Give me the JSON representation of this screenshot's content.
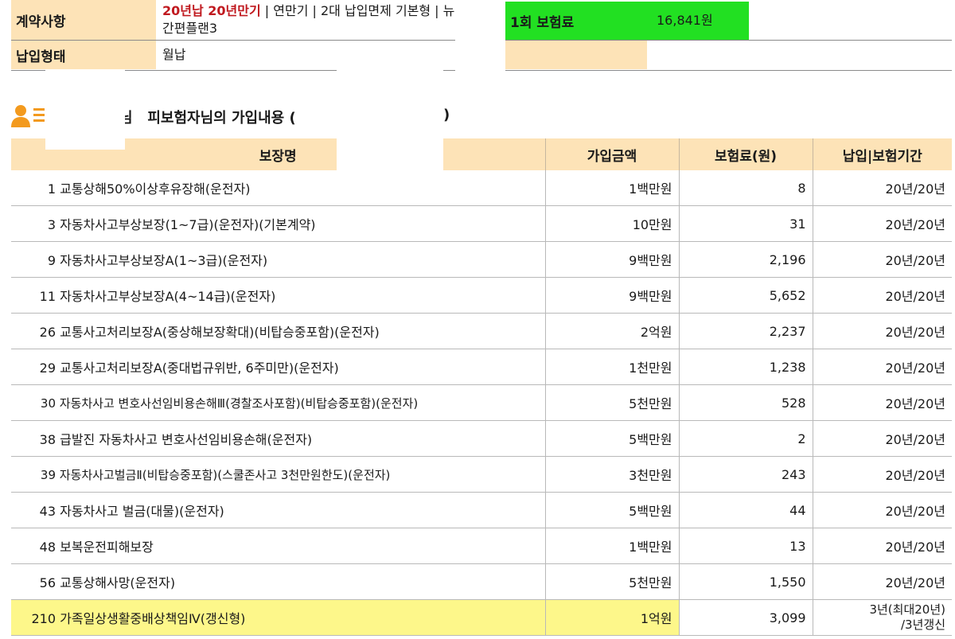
{
  "header": {
    "contract_label": "계약사항",
    "contract_value_red": "20년납 20년만기",
    "contract_value_rest": " |  연만기 | 2대 납입면제 기본형 | 뉴간편플랜3",
    "payment_label": "납입형태",
    "payment_value": "월납",
    "premium_label": "1회 보험료",
    "premium_value": "16,841원"
  },
  "section": {
    "title_part1": "님",
    "title_part2": "피보험자님의 가입내용 (",
    "title_part3": ")"
  },
  "table": {
    "headers": [
      "보장명",
      "가입금액",
      "보험료(원)",
      "납입|보험기간"
    ],
    "rows": [
      {
        "no": "1",
        "name": "교통상해50%이상후유장해(운전자)",
        "amount": "1백만원",
        "premium": "8",
        "period": "20년/20년"
      },
      {
        "no": "3",
        "name": "자동차사고부상보장(1~7급)(운전자)(기본계약)",
        "amount": "10만원",
        "premium": "31",
        "period": "20년/20년"
      },
      {
        "no": "9",
        "name": "자동차사고부상보장A(1~3급)(운전자)",
        "amount": "9백만원",
        "premium": "2,196",
        "period": "20년/20년"
      },
      {
        "no": "11",
        "name": "자동차사고부상보장A(4~14급)(운전자)",
        "amount": "9백만원",
        "premium": "5,652",
        "period": "20년/20년"
      },
      {
        "no": "26",
        "name": "교통사고처리보장A(중상해보장확대)(비탑승중포함)(운전자)",
        "amount": "2억원",
        "premium": "2,237",
        "period": "20년/20년"
      },
      {
        "no": "29",
        "name": "교통사고처리보장A(중대법규위반, 6주미만)(운전자)",
        "amount": "1천만원",
        "premium": "1,238",
        "period": "20년/20년"
      },
      {
        "no": "30",
        "name": "자동차사고 변호사선임비용손해Ⅲ(경찰조사포함)(비탑승중포함)(운전자)",
        "amount": "5천만원",
        "premium": "528",
        "period": "20년/20년"
      },
      {
        "no": "38",
        "name": "급발진 자동차사고 변호사선임비용손해(운전자)",
        "amount": "5백만원",
        "premium": "2",
        "period": "20년/20년"
      },
      {
        "no": "39",
        "name": "자동차사고벌금Ⅱ(비탑승중포함)(스쿨존사고 3천만원한도)(운전자)",
        "amount": "3천만원",
        "premium": "243",
        "period": "20년/20년"
      },
      {
        "no": "43",
        "name": "자동차사고 벌금(대물)(운전자)",
        "amount": "5백만원",
        "premium": "44",
        "period": "20년/20년"
      },
      {
        "no": "48",
        "name": "보복운전피해보장",
        "amount": "1백만원",
        "premium": "13",
        "period": "20년/20년"
      },
      {
        "no": "56",
        "name": "교통상해사망(운전자)",
        "amount": "5천만원",
        "premium": "1,550",
        "period": "20년/20년"
      },
      {
        "no": "210",
        "name": "가족일상생활중배상책임Ⅳ(갱신형)",
        "amount": "1억원",
        "premium": "3,099",
        "period_line1": "3년(최대20년)",
        "period_line2": "/3년갱신"
      }
    ]
  },
  "colors": {
    "label_bg": "#fde3b7",
    "premium_highlight": "#22e022",
    "row_highlight": "#fdf78a",
    "accent_red": "#c0191f",
    "icon_orange": "#f39a1e"
  }
}
